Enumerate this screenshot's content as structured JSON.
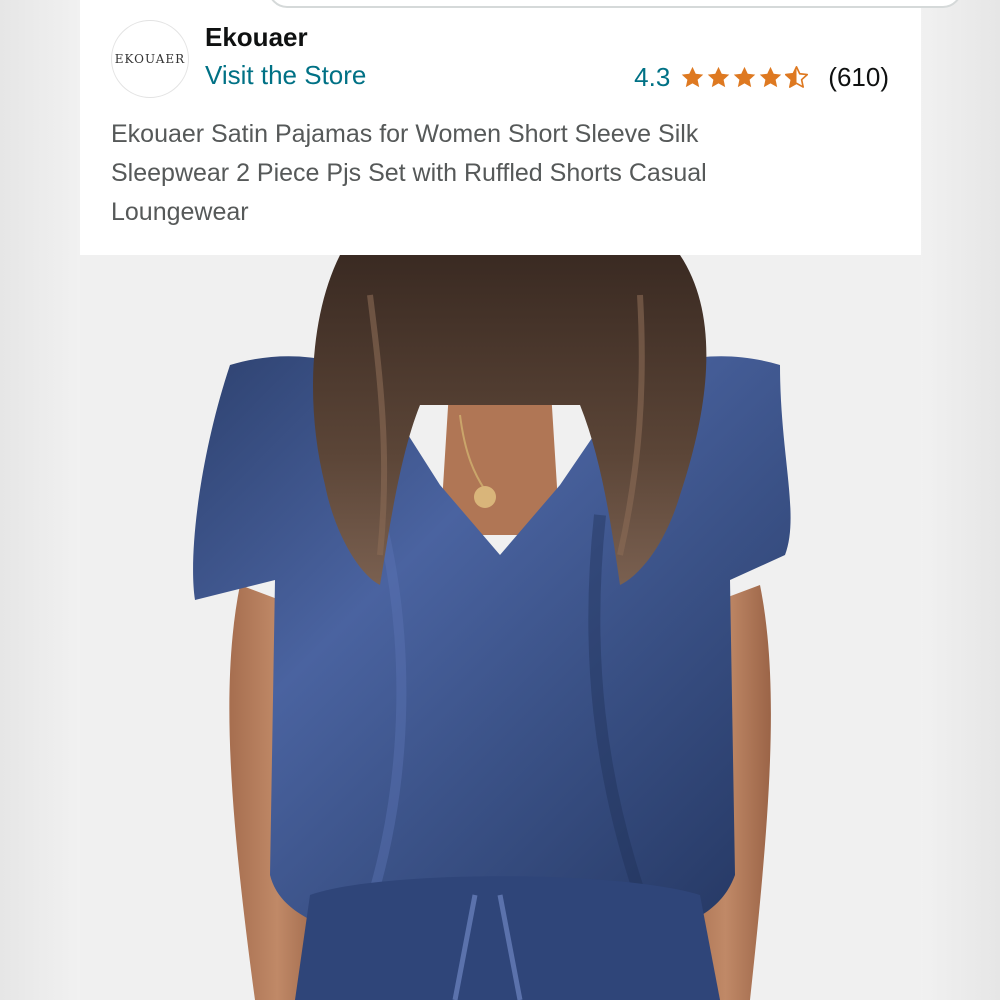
{
  "store": {
    "logo_text": "EKOUAER",
    "brand_name": "Ekouaer",
    "visit_label": "Visit the Store"
  },
  "rating": {
    "value": "4.3",
    "stars": 4.3,
    "review_count": "(610)",
    "star_color": "#de7921"
  },
  "product": {
    "title": "Ekouaer Satin Pajamas for Women Short Sleeve Silk Sleepwear 2 Piece Pjs Set with Ruffled Shorts Casual Loungewear"
  },
  "colors": {
    "link": "#007185",
    "text_primary": "#0f1111",
    "text_secondary": "#565959",
    "garment": "#3c5486"
  }
}
